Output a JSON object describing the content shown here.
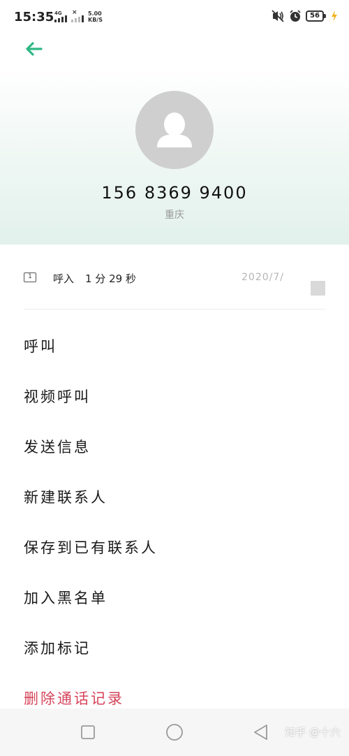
{
  "status_bar": {
    "time": "15:35",
    "sim1_network": "4G",
    "sim2_network": "×",
    "net_speed_value": "5.00",
    "net_speed_unit": "KB/S",
    "battery_level": "56",
    "icons": [
      "mute-vibrate-icon",
      "alarm-icon",
      "battery-icon",
      "charging-icon"
    ]
  },
  "header": {
    "back_icon": "arrow-left-icon",
    "accent_color": "#2fb884",
    "phone_number": "156 8369 9400",
    "location": "重庆"
  },
  "call_record": {
    "sim_label": "1",
    "type": "呼入",
    "duration": "1 分 29 秒",
    "date": "2020/7/"
  },
  "menu": {
    "items": [
      {
        "label": "呼叫"
      },
      {
        "label": "视频呼叫"
      },
      {
        "label": "发送信息"
      },
      {
        "label": "新建联系人"
      },
      {
        "label": "保存到已有联系人"
      },
      {
        "label": "加入黑名单"
      },
      {
        "label": "添加标记"
      },
      {
        "label": "删除通话记录"
      }
    ],
    "danger_color": "#d6455b"
  },
  "nav_bar": {
    "icons": [
      "recent-apps-square-icon",
      "home-circle-icon",
      "back-triangle-icon"
    ],
    "watermark": "知乎 @十六"
  }
}
